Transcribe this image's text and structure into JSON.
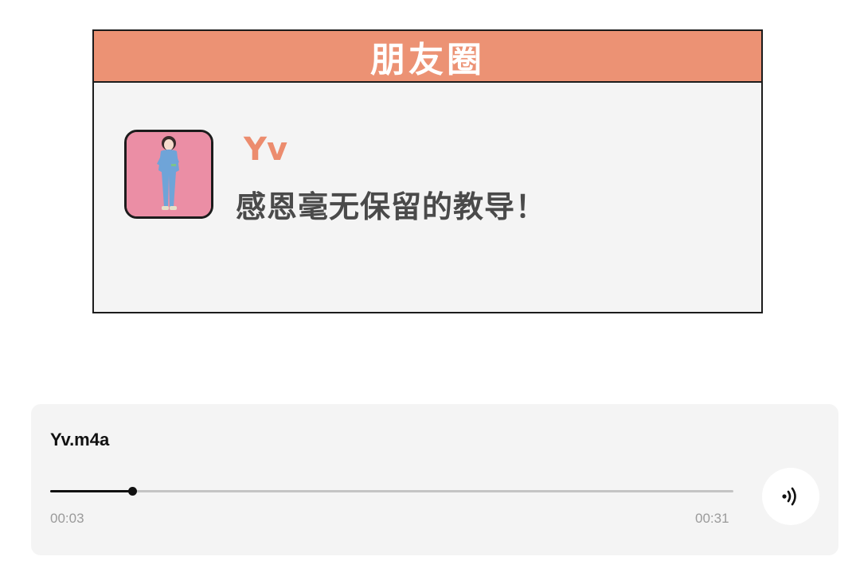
{
  "moments": {
    "title": "朋友圈",
    "author": "Yv",
    "text": "感恩毫无保留的教导！",
    "header_color": "#ec9274",
    "author_color": "#ec8c6e"
  },
  "player": {
    "file_name": "Yv.m4a",
    "current_time": "00:03",
    "total_time": "00:31",
    "progress": 0.12,
    "volume_icon": "volume-icon"
  }
}
